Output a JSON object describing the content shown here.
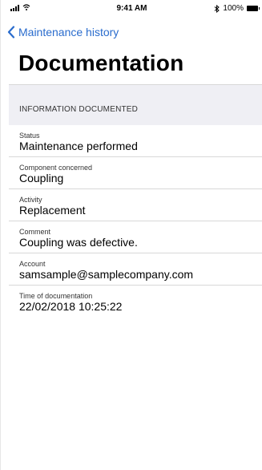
{
  "status_bar": {
    "time": "9:41 AM",
    "battery": "100%",
    "icons": [
      "signal-icon",
      "wifi-icon",
      "bluetooth-icon",
      "battery-icon"
    ]
  },
  "nav": {
    "back_label": "Maintenance history",
    "back_icon": "chevron-left-icon"
  },
  "page": {
    "title": "Documentation"
  },
  "section": {
    "header": "INFORMATION DOCUMENTED"
  },
  "details": [
    {
      "label": "Status",
      "value": "Maintenance performed"
    },
    {
      "label": "Component concerned",
      "value": "Coupling"
    },
    {
      "label": "Activity",
      "value": "Replacement"
    },
    {
      "label": "Comment",
      "value": "Coupling was defective."
    },
    {
      "label": "Account",
      "value": "samsample@samplecompany.com"
    },
    {
      "label": "Time of documentation",
      "value": "22/02/2018 10:25:22"
    }
  ],
  "colors": {
    "accent": "#2a6ccd",
    "section_bg": "#efeff4",
    "divider": "#d8d8d8"
  }
}
